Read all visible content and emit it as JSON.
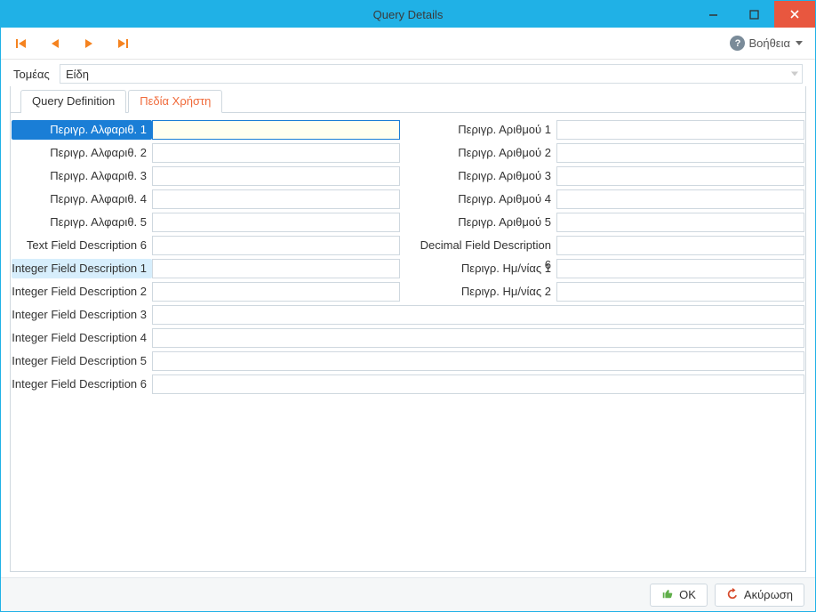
{
  "window": {
    "title": "Query Details"
  },
  "toolbar": {
    "help_label": "Βοήθεια"
  },
  "domain": {
    "label": "Τομέας",
    "value": "Είδη"
  },
  "tabs": {
    "definition": "Query Definition",
    "userfields": "Πεδία Χρήστη"
  },
  "labels_left": {
    "alpha1": "Περιγρ. Αλφαριθ. 1",
    "alpha2": "Περιγρ. Αλφαριθ. 2",
    "alpha3": "Περιγρ. Αλφαριθ. 3",
    "alpha4": "Περιγρ. Αλφαριθ. 4",
    "alpha5": "Περιγρ. Αλφαριθ. 5",
    "text6": "Text Field Description 6",
    "int1": "Integer Field Description 1",
    "int2": "Integer Field Description 2"
  },
  "labels_right": {
    "num1": "Περιγρ. Αριθμού 1",
    "num2": "Περιγρ. Αριθμού 2",
    "num3": "Περιγρ. Αριθμού 3",
    "num4": "Περιγρ. Αριθμού 4",
    "num5": "Περιγρ. Αριθμού 5",
    "dec6": "Decimal Field Description 6",
    "date1": "Περιγρ. Ημ/νίας 1",
    "date2": "Περιγρ. Ημ/νίας 2"
  },
  "labels_full": {
    "int3": "Integer Field Description 3",
    "int4": "Integer Field Description 4",
    "int5": "Integer Field Description 5",
    "int6": "Integer Field Description 6"
  },
  "buttons": {
    "ok": "OK",
    "cancel": "Ακύρωση"
  }
}
